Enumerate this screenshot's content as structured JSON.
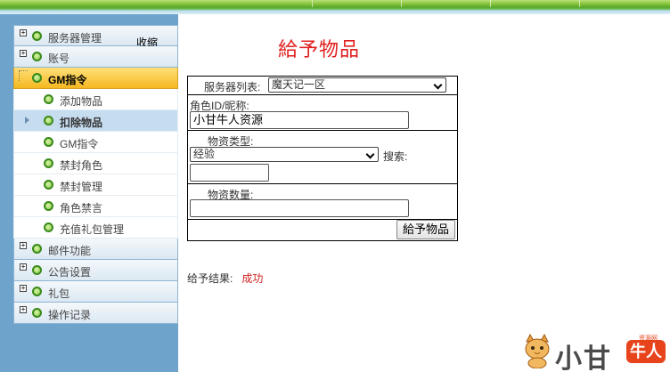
{
  "sidebar": {
    "collapse_label": "收缩",
    "items": [
      {
        "label": "服务器管理",
        "has_plus": true
      },
      {
        "label": "账号",
        "has_plus": true
      },
      {
        "label": "GM指令",
        "active": true
      },
      {
        "label": "添加物品",
        "sub": true
      },
      {
        "label": "扣除物品",
        "sub": true,
        "selected": true
      },
      {
        "label": "GM指令",
        "sub": true
      },
      {
        "label": "禁封角色",
        "sub": true
      },
      {
        "label": "禁封管理",
        "sub": true
      },
      {
        "label": "角色禁言",
        "sub": true
      },
      {
        "label": "充值礼包管理",
        "sub": true
      },
      {
        "label": "邮件功能",
        "has_plus": true
      },
      {
        "label": "公告设置",
        "has_plus": true
      },
      {
        "label": "礼包",
        "has_plus": true
      },
      {
        "label": "操作记录",
        "has_plus": true
      }
    ]
  },
  "page": {
    "title": "給予物品"
  },
  "form": {
    "server_label": "服务器列表:",
    "server_value": "魔天记一区",
    "role_label": "角色ID/昵称:",
    "role_value": "小甘牛人资源",
    "type_label": "物资类型:",
    "type_value": "经验",
    "search_label": "搜索:",
    "search_value": "",
    "qty_label": "物资数量:",
    "qty_value": "",
    "submit_label": "給予物品"
  },
  "result": {
    "label": "给予结果:",
    "value": "成功"
  },
  "watermark": {
    "text": "小甘",
    "tag": "牛人",
    "small": "资源网"
  },
  "colors": {
    "title": "#e02020",
    "success": "#d02020",
    "sidebar_bg": "#6ea3cc",
    "active_item": "#f5b820"
  }
}
